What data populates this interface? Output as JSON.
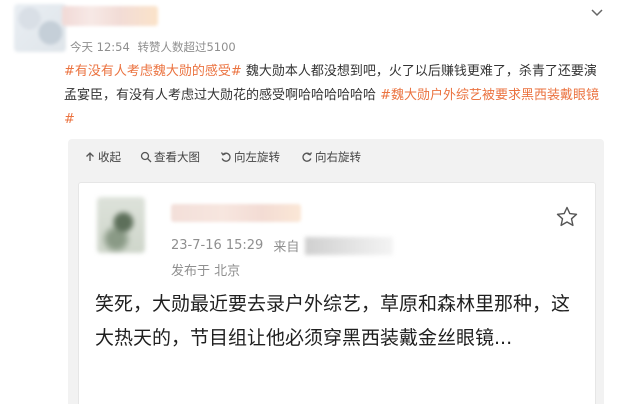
{
  "post": {
    "time": "今天 12:54",
    "likes_info": "转赞人数超过5100",
    "text_parts": [
      {
        "type": "tag",
        "text": "#有没有人考虑魏大勋的感受#"
      },
      {
        "type": "text",
        "text": " 魏大勋本人都没想到吧，火了以后赚钱更难了，杀青了还要演孟宴臣，有没有人考虑过大勋花的感受啊哈哈哈哈哈哈 "
      },
      {
        "type": "tag",
        "text": "#魏大勋户外综艺被要求黑西装戴眼镜#"
      }
    ]
  },
  "actions": {
    "collapse": "收起",
    "view_large": "查看大图",
    "rotate_left": "向左旋转",
    "rotate_right": "向右旋转"
  },
  "repost": {
    "time": "23-7-16 15:29",
    "source_prefix": "来自",
    "location": "发布于 北京",
    "text": "笑死，大勋最近要去录户外综艺，草原和森林里那种，这大热天的，节目组让他必须穿黑西装戴金丝眼镜..."
  },
  "colors": {
    "tag": "#eb7340",
    "meta": "#8f8f8f",
    "action_bg": "#f2f2f2"
  }
}
